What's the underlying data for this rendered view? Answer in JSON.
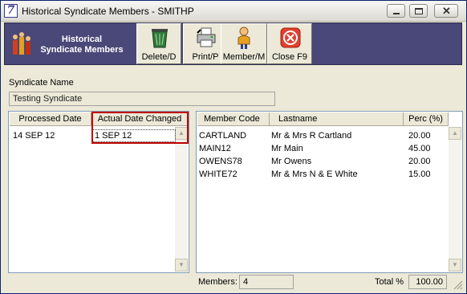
{
  "window": {
    "title": "Historical Syndicate Members  - SMITHP",
    "app_icon_glyph": "7"
  },
  "toolbar": {
    "title_line1": "Historical",
    "title_line2": "Syndicate Members",
    "buttons": [
      {
        "label": "Delete/D",
        "icon": "trash-icon"
      },
      {
        "label": "Print/P",
        "icon": "printer-icon"
      },
      {
        "label": "Member/M",
        "icon": "member-icon"
      },
      {
        "label": "Close F9",
        "icon": "close-circle-icon"
      }
    ]
  },
  "syndicate": {
    "label": "Syndicate Name",
    "value": "Testing Syndicate"
  },
  "history_table": {
    "columns": [
      "Processed Date",
      "Actual Date Changed"
    ],
    "rows": [
      [
        "14 SEP 12",
        "1 SEP 12"
      ]
    ]
  },
  "members_table": {
    "columns": [
      "Member Code",
      "Lastname",
      "Perc (%)"
    ],
    "rows": [
      [
        "CARTLAND",
        "Mr & Mrs R Cartland",
        "20.00"
      ],
      [
        "MAIN12",
        "Mr Main",
        "45.00"
      ],
      [
        "OWENS78",
        "Mr Owens",
        "20.00"
      ],
      [
        "WHITE72",
        "Mr & Mrs N & E White",
        "15.00"
      ]
    ]
  },
  "footer": {
    "members_label": "Members:",
    "members_value": "4",
    "total_label": "Total %",
    "total_value": "100.00"
  },
  "colors": {
    "toolbar_bg": "#4a4878",
    "highlight": "#c00000"
  }
}
